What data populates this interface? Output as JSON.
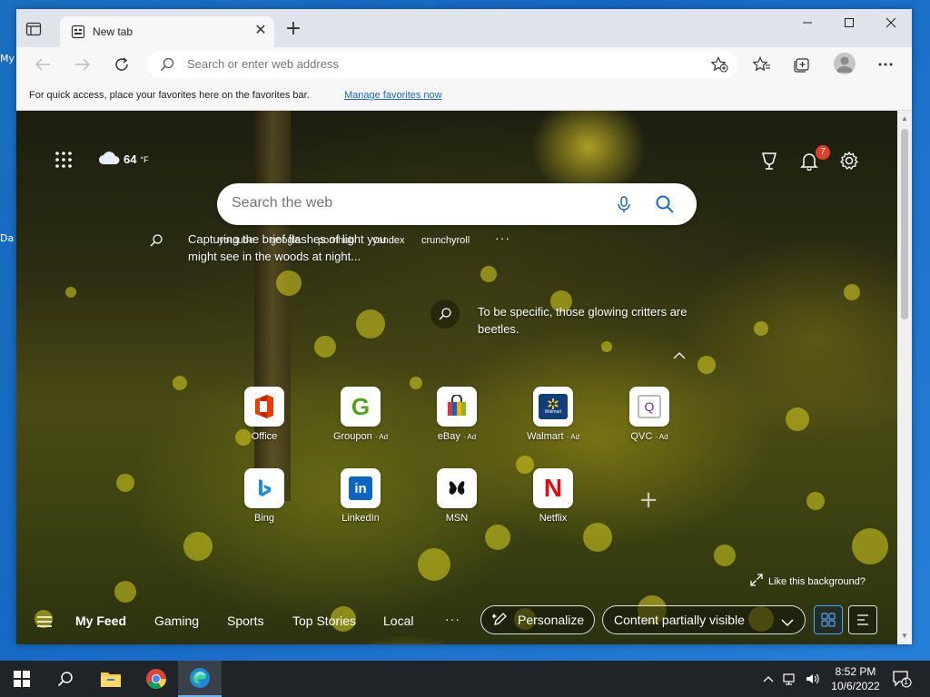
{
  "desktop": {
    "frag1": "My",
    "frag2": "Da"
  },
  "tab": {
    "title": "New tab"
  },
  "toolbar": {
    "address_placeholder": "Search or enter web address"
  },
  "favbar": {
    "text": "For quick access, place your favorites here on the favorites bar.",
    "link": "Manage favorites now"
  },
  "ntp": {
    "weather_temp": "64",
    "weather_unit": "°F",
    "notification_count": "7",
    "search_placeholder": "Search the web",
    "quicklinks": [
      "youtube",
      "google",
      "pornhub",
      "yandex",
      "crunchyroll"
    ],
    "quicklinks_more": "···",
    "caption1": "Capturing the brief flashes of light you might see in the woods at night...",
    "caption2": "To be specific, those glowing critters are beetles.",
    "tiles": [
      {
        "label": "Office",
        "ad": ""
      },
      {
        "label": "Groupon",
        "ad": "· Ad"
      },
      {
        "label": "eBay",
        "ad": "· Ad"
      },
      {
        "label": "Walmart",
        "ad": "· Ad"
      },
      {
        "label": "QVC",
        "ad": "· Ad"
      },
      {
        "label": "Bing",
        "ad": ""
      },
      {
        "label": "LinkedIn",
        "ad": ""
      },
      {
        "label": "MSN",
        "ad": ""
      },
      {
        "label": "Netflix",
        "ad": ""
      }
    ],
    "tile_glyphs": {
      "groupon": "G",
      "walmart": "Walmart",
      "qvc": "Q",
      "linkedin": "in",
      "netflix": "N"
    },
    "like_background": "Like this background?"
  },
  "feed": {
    "tabs": [
      "My Feed",
      "Gaming",
      "Sports",
      "Top Stories",
      "Local"
    ],
    "more": "···",
    "personalize": "Personalize",
    "content_visibility": "Content partially visible"
  },
  "taskbar": {
    "time": "8:52 PM",
    "date": "10/6/2022",
    "notification_count": "1"
  },
  "colors": {
    "accent": "#1a67c8",
    "badge": "#e0402a",
    "taskbar": "#1f2429"
  }
}
